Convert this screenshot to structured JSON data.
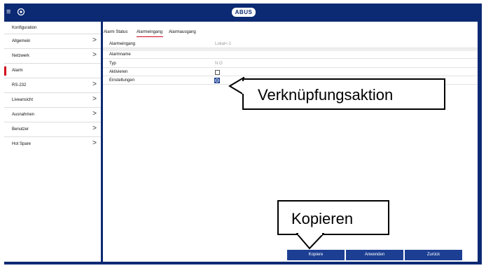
{
  "header": {
    "menu_icon": "hamburger-icon",
    "settings_icon": "gear-icon",
    "logo_text": "ABUS"
  },
  "sidebar": {
    "title": "Konfiguration",
    "items": [
      {
        "label": "Allgemein",
        "chevron": ">"
      },
      {
        "label": "Netzwerk",
        "chevron": ">"
      },
      {
        "label": "Alarm",
        "chevron": ""
      },
      {
        "label": "RS-232",
        "chevron": ">"
      },
      {
        "label": "Liveansicht",
        "chevron": ">"
      },
      {
        "label": "Ausnahmen",
        "chevron": ">"
      },
      {
        "label": "Benutzer",
        "chevron": ">"
      },
      {
        "label": "Hot Spare",
        "chevron": ">"
      }
    ],
    "active_index": 2,
    "accent_color": "#d0021b"
  },
  "tabs": [
    {
      "label": "Alarm Status"
    },
    {
      "label": "Alarmeingang"
    },
    {
      "label": "Alarmausgang"
    }
  ],
  "form": {
    "rows": [
      {
        "label": "Alarmeingang",
        "value": "Lokal<-1"
      },
      {
        "label": "Alarmname",
        "value": ""
      },
      {
        "label": "Typ",
        "value": "N.O"
      },
      {
        "label": "Aktivieren",
        "value": ""
      },
      {
        "label": "Einstellungen",
        "value": ""
      }
    ],
    "aktivieren_checked": false
  },
  "callouts": {
    "link_action": "Verknüpfungsaktion",
    "copy": "Kopieren"
  },
  "buttons": {
    "kopiere": "Kopiere",
    "anwenden": "Anwenden",
    "zurueck": "Zurück"
  },
  "colors": {
    "frame": "#0c2a73",
    "button": "#1c3f94"
  }
}
